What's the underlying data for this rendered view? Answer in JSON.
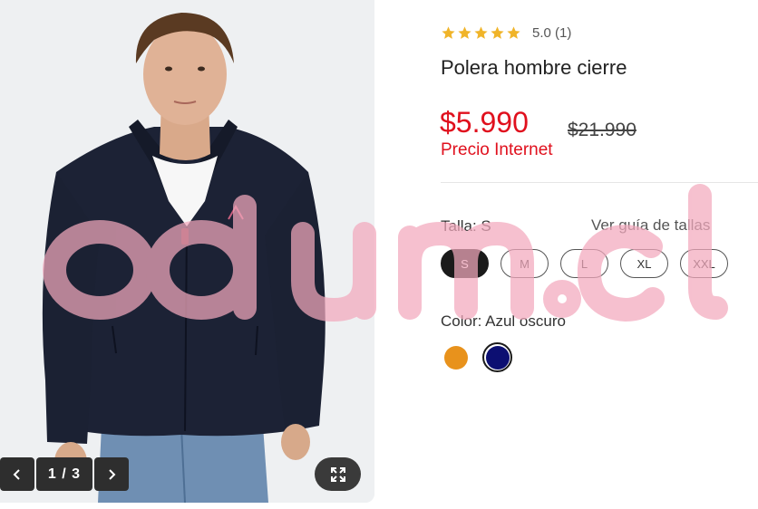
{
  "gallery": {
    "counter": "1 / 3",
    "prev_icon": "chevron-left-icon",
    "next_icon": "chevron-right-icon",
    "expand_icon": "expand-icon"
  },
  "product": {
    "rating_value": 5.0,
    "rating_text": "5.0 (1)",
    "title": "Polera hombre cierre",
    "price": "$5.990",
    "old_price": "$21.990",
    "price_label": "Precio Internet"
  },
  "size": {
    "label": "Talla: S",
    "guide_link": "Ver guía de tallas",
    "options": [
      "S",
      "M",
      "L",
      "XL",
      "XXL"
    ],
    "selected": "S"
  },
  "color": {
    "label": "Color: Azul oscuro",
    "options": [
      {
        "name": "orange-swatch",
        "hex": "#e8921c"
      },
      {
        "name": "dark-blue-swatch",
        "hex": "#0c0f72"
      }
    ],
    "selected_index": 1
  },
  "watermark": {
    "text": "odum.cl",
    "color": "#f3a9bd"
  },
  "colors": {
    "accent_red": "#e0101d",
    "star": "#f0b429",
    "jacket": "#1c2235"
  }
}
